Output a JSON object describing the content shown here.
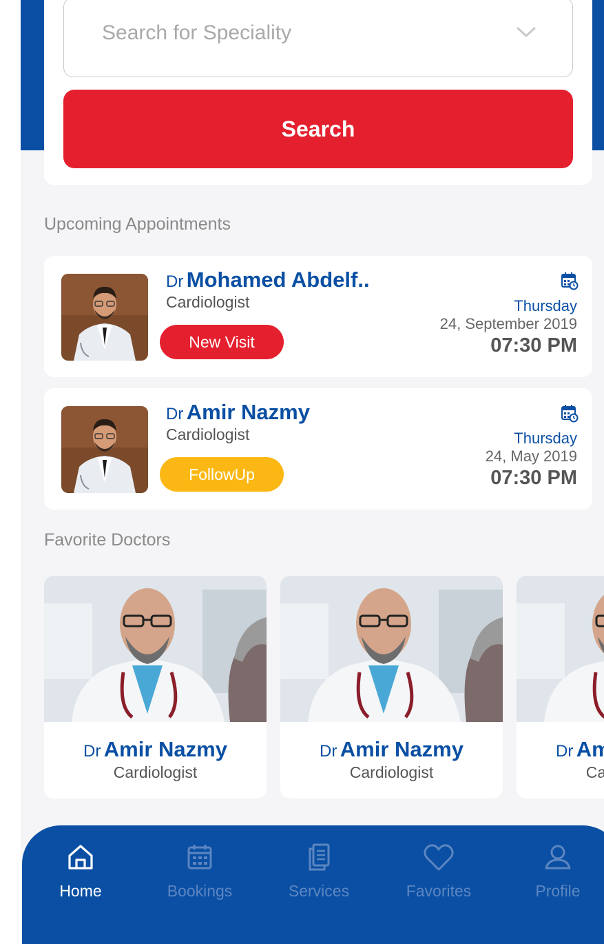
{
  "search": {
    "placeholder": "Search for Speciality",
    "button_label": "Search"
  },
  "sections": {
    "upcoming": "Upcoming Appointments",
    "favorites": "Favorite Doctors"
  },
  "appointments": [
    {
      "prefix": "Dr",
      "name": "Mohamed Abdelf..",
      "specialty": "Cardiologist",
      "visit_type": "New Visit",
      "visit_color": "#e5202e",
      "day": "Thursday",
      "date": "24, September 2019",
      "time": "07:30 PM"
    },
    {
      "prefix": "Dr",
      "name": "Amir Nazmy",
      "specialty": "Cardiologist",
      "visit_type": "FollowUp",
      "visit_color": "#fbb814",
      "day": "Thursday",
      "date": "24, May 2019",
      "time": "07:30 PM"
    }
  ],
  "favorite_doctors": [
    {
      "prefix": "Dr",
      "name": "Amir Nazmy",
      "specialty": "Cardiologist"
    },
    {
      "prefix": "Dr",
      "name": "Amir Nazmy",
      "specialty": "Cardiologist"
    },
    {
      "prefix": "Dr",
      "name": "Amir Nazmy",
      "specialty": "Cardiologist"
    }
  ],
  "tabs": [
    {
      "label": "Home",
      "icon": "home-icon",
      "active": true
    },
    {
      "label": "Bookings",
      "icon": "calendar-icon",
      "active": false
    },
    {
      "label": "Services",
      "icon": "document-icon",
      "active": false
    },
    {
      "label": "Favorites",
      "icon": "heart-icon",
      "active": false
    },
    {
      "label": "Profile",
      "icon": "user-icon",
      "active": false
    }
  ],
  "colors": {
    "brand_blue": "#0a4fa3",
    "accent_red": "#e5202e",
    "accent_yellow": "#fbb814",
    "tab_inactive": "#5c86c1"
  }
}
